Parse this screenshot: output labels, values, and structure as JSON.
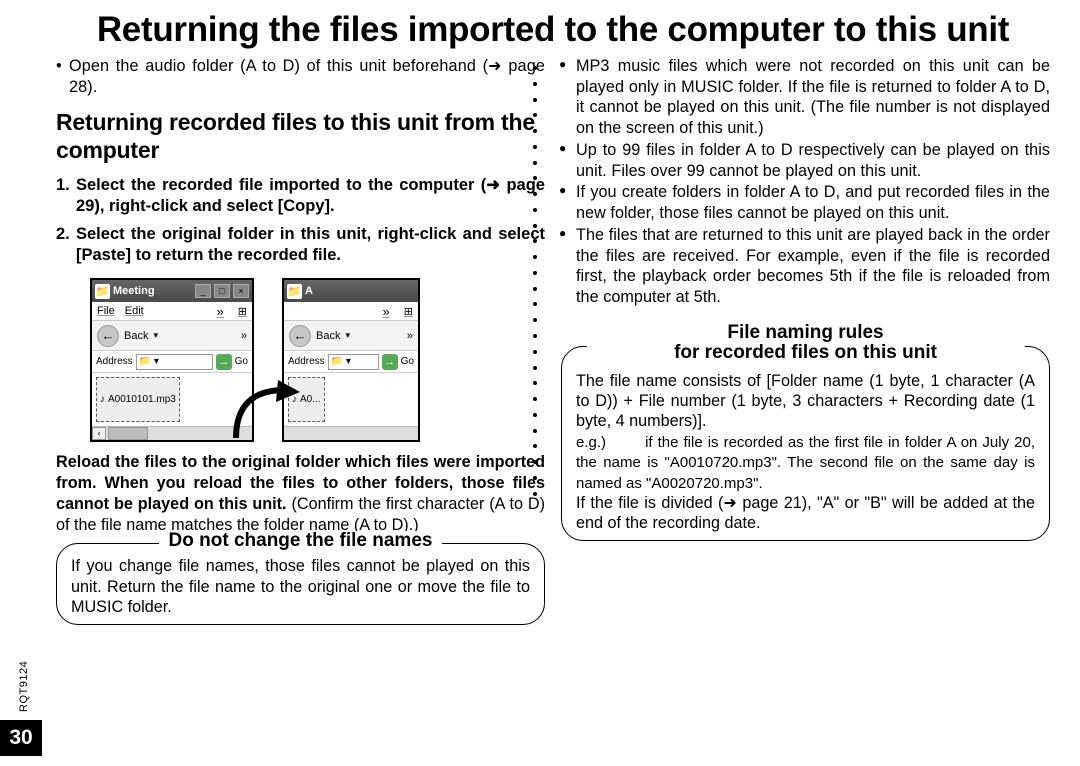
{
  "title": "Returning the files imported to the computer to this unit",
  "intro": "Open the audio folder (A to D) of this unit beforehand (➜ page 28).",
  "subheading": "Returning recorded files to this unit from the computer",
  "steps": [
    "Select the recorded file imported to the computer (➜ page 29), right-click and select [Copy].",
    "Select the original folder in this unit, right-click and select [Paste] to return the recorded file."
  ],
  "figure": {
    "win1": {
      "title": "Meeting",
      "menu": [
        "File",
        "Edit"
      ],
      "back": "Back",
      "addr_label": "Address",
      "go": "Go",
      "file": "A0010101.mp3"
    },
    "win2": {
      "title": "A",
      "menu": [],
      "back": "Back",
      "addr_label": "Address",
      "go": "Go",
      "file": "A0..."
    }
  },
  "reload": {
    "bold": "Reload the files to the original folder which files were imported from. When you reload the files to other folders, those files cannot be played on this unit.",
    "plain": " (Confirm the first character (A to D) of the file name matches the folder name (A to D).)"
  },
  "box1": {
    "title": "Do not change the file names",
    "body": "If you change file names, those files cannot be played on this unit. Return the file name to the original one or move the file to MUSIC folder."
  },
  "right": [
    "MP3 music files which were not recorded on this unit can be played only in MUSIC folder. If the file is returned to folder A to D, it cannot be played on this unit. (The file number is not displayed on the screen of this unit.)",
    "Up to 99 files in folder A to D respectively can be played on this unit. Files over 99 cannot be played on this unit.",
    "If you create folders in folder A to D, and put recorded files in the new folder, those files cannot be played on this unit.",
    "The files that are returned to this unit are played back in the order the files are received. For example, even if the file is recorded first, the playback order becomes 5th if the file is reloaded from the computer at 5th."
  ],
  "box2": {
    "title_l1": "File naming rules",
    "title_l2": "for recorded files on this unit",
    "p1": "The file name consists of [Folder name (1 byte, 1 character (A to D)) + File number (1 byte, 3 characters + Recording date (1 byte, 4 numbers)].",
    "eg_label": "e.g.)",
    "eg": "if the file is recorded as the first file in folder A on July 20, the name is \"A0010720.mp3\". The second file on the same day is named as \"A0020720.mp3\".",
    "p2": "If the file is divided (➜ page 21), \"A\" or \"B\" will be added at the end of the recording date."
  },
  "page_number": "30",
  "doc_id": "RQT9124"
}
